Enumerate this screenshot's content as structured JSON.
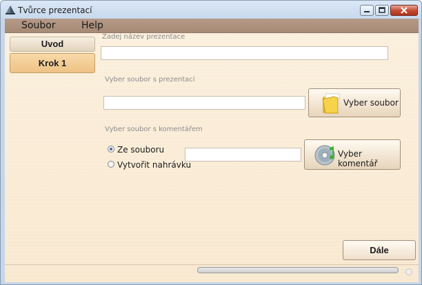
{
  "window": {
    "title": "Tvůrce prezentací",
    "app_icon": "pyramid-icon"
  },
  "caption_buttons": [
    "minimize-icon",
    "maximize-icon",
    "close-icon"
  ],
  "menu": {
    "items": [
      "Soubor",
      "Help"
    ]
  },
  "sidebar": {
    "tabs": [
      {
        "label": "Uvod",
        "active": false
      },
      {
        "label": "Krok 1",
        "active": true
      }
    ]
  },
  "form": {
    "title_label": "Zadej název prezentace",
    "title_value": "",
    "presentation_file_label": "Vyber soubor s prezentací",
    "presentation_file_value": "",
    "select_file_button": "Vyber soubor",
    "select_file_icon": "folder-icon",
    "comment_label": "Vyber soubor s komentářem",
    "radio_from_file": "Ze souboru",
    "radio_record": "Vytvořit nahrávku",
    "selected_radio": "Ze souboru",
    "comment_file_value": "",
    "select_comment_button": "Vyber komentář",
    "select_comment_icon": "audio-cd-icon",
    "next_button": "Dále"
  },
  "status": {
    "progress": 0,
    "colors": {
      "progress_fill": "#5aa04a"
    }
  },
  "colors": {
    "menubar": "#a68a76",
    "background": "#f8e8cf",
    "active_tab": "#eec285"
  }
}
